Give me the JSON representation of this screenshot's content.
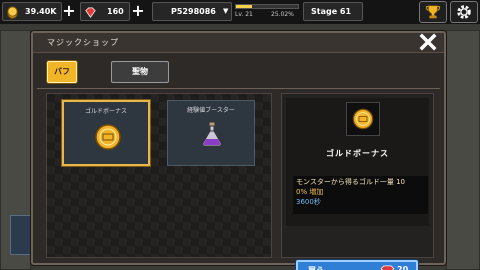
{
  "hud": {
    "gold": "39.40K",
    "gems": "160",
    "player_id": "P5298086",
    "level": "Lv. 21",
    "exp_percent": "25.02%",
    "exp_fraction": 0.2502,
    "stage": "Stage 61"
  },
  "dialog": {
    "title": "マジックショップ",
    "tabs": [
      {
        "label": "バフ",
        "active": true
      },
      {
        "label": "聖物",
        "active": false
      }
    ],
    "items": [
      {
        "name": "ゴルドボーナス",
        "icon": "gold-coin-icon",
        "selected": true
      },
      {
        "name": "経験値ブースター",
        "icon": "potion-icon",
        "selected": false
      }
    ],
    "detail": {
      "name": "ゴルドボーナス",
      "icon": "gold-coin-icon",
      "desc_line1": "モンスターから得るゴルド一量 10",
      "desc_line2": "0% 増加",
      "duration": "3600秒",
      "buy_label": "買う",
      "price": "20"
    }
  },
  "colors": {
    "accent_gold": "#f1b628",
    "buy_blue": "#2f7fd6",
    "desc_gold": "#f3c24a",
    "duration_blue": "#6fb8f0"
  }
}
